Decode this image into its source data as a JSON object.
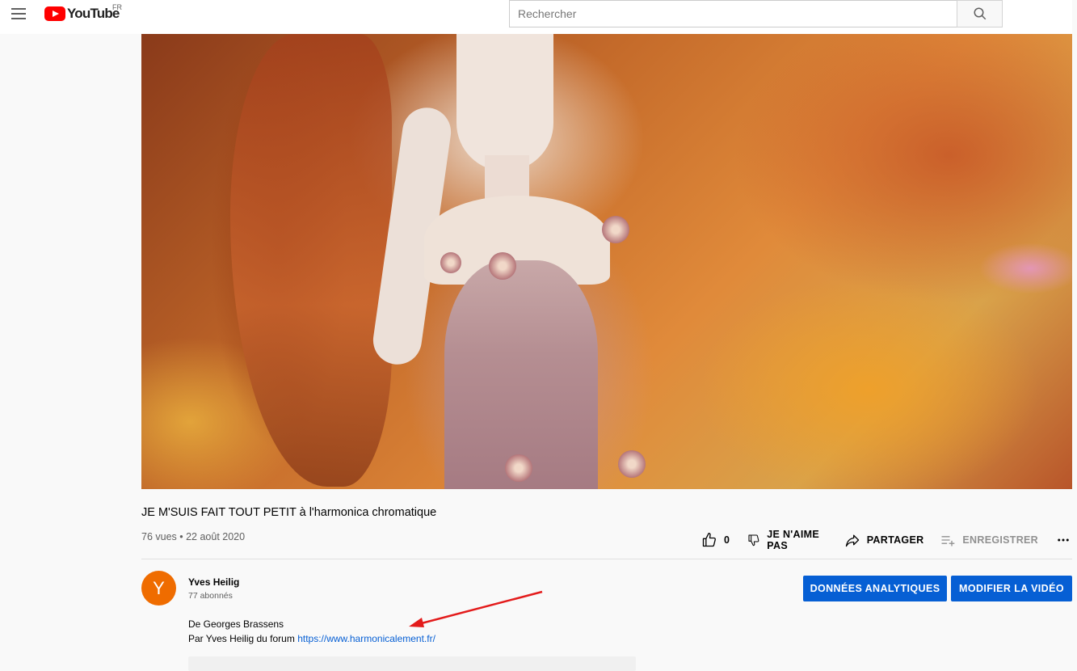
{
  "masthead": {
    "logo_text": "YouTube",
    "country_code": "FR",
    "search_placeholder": "Rechercher"
  },
  "video": {
    "title": "JE M'SUIS FAIT TOUT PETIT à l'harmonica chromatique",
    "meta": "76 vues • 22 août 2020",
    "like_count": "0",
    "dislike_label": "JE N'AIME PAS",
    "share_label": "PARTAGER",
    "save_label": "ENREGISTRER"
  },
  "owner": {
    "avatar_letter": "Y",
    "channel_name": "Yves Heilig",
    "subscribers": "77 abonnés",
    "analytics_button": "DONNÉES ANALYTIQUES",
    "edit_button": "MODIFIER LA VIDÉO"
  },
  "description": {
    "line1": "De Georges Brassens",
    "line2_prefix": "Par Yves Heilig du forum",
    "link": "https://www.harmonicalement.fr/"
  },
  "colors": {
    "brand_red": "#ff0000",
    "accent_blue": "#065fd4",
    "avatar_orange": "#ef6c00",
    "annotation_arrow": "#e31b1b"
  }
}
